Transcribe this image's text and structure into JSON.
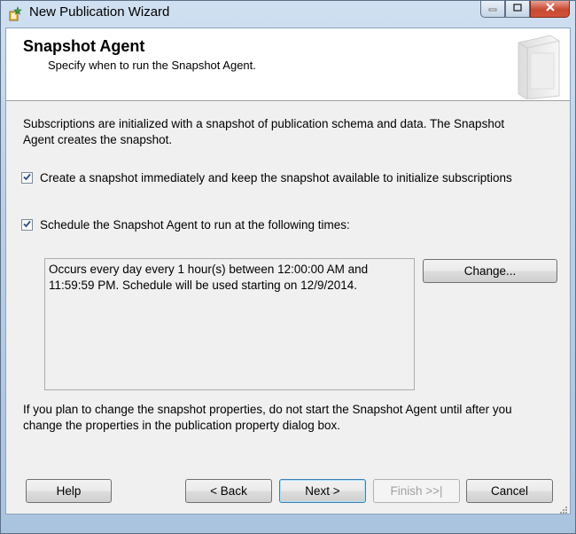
{
  "window": {
    "title": "New Publication Wizard"
  },
  "header": {
    "title": "Snapshot Agent",
    "subtitle": "Specify when to run the Snapshot Agent."
  },
  "content": {
    "intro_line1": "Subscriptions are initialized with a snapshot of publication schema and data. The Snapshot",
    "intro_line2": "Agent creates the snapshot.",
    "create_snapshot_label": "Create a snapshot immediately and keep the snapshot available to initialize subscriptions",
    "create_snapshot_checked": true,
    "schedule_label": "Schedule the Snapshot Agent to run at the following times:",
    "schedule_checked": true,
    "schedule_line1": "Occurs every day every 1 hour(s) between 12:00:00 AM and",
    "schedule_line2": "11:59:59 PM. Schedule will be used starting on 12/9/2014.",
    "change_button": "Change...",
    "note_line1": "If you plan to change the snapshot properties, do not start the Snapshot Agent until after you",
    "note_line2": "change the properties in the publication property dialog box."
  },
  "footer": {
    "help": "Help",
    "back": "< Back",
    "next": "Next >",
    "finish": "Finish >>|",
    "cancel": "Cancel"
  },
  "icons": {
    "app": "wizard-icon",
    "minimize": "minimize-icon",
    "maximize": "maximize-icon",
    "close": "close-icon",
    "header_art": "book-icon",
    "check": "checkmark-icon"
  },
  "colors": {
    "close_button": "#c74a32",
    "default_button_border": "#3c7fb1"
  }
}
